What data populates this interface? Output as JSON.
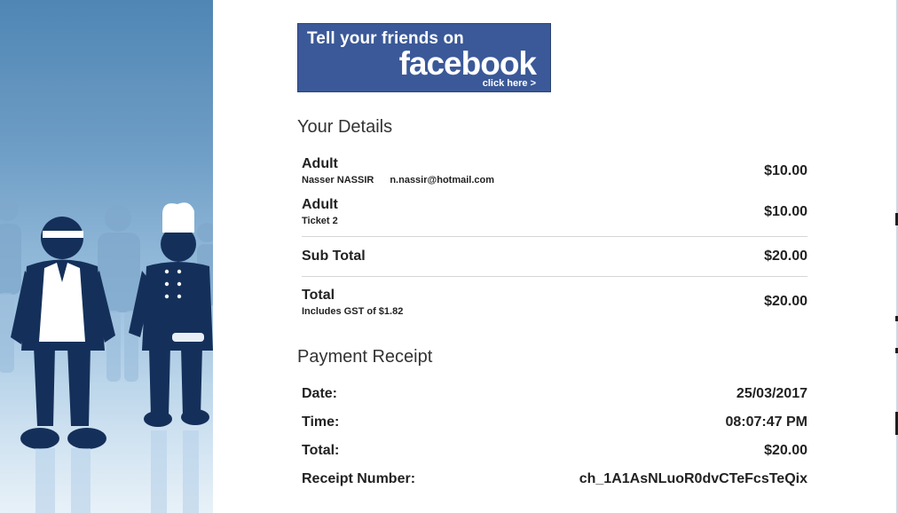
{
  "facebook_banner": {
    "line1": "Tell your friends on",
    "brand": "facebook",
    "cta": "click here >"
  },
  "your_details": {
    "title": "Your Details",
    "items": [
      {
        "type": "Adult",
        "name": "Nasser NASSIR",
        "email": "n.nassir@hotmail.com",
        "amount": "$10.00"
      },
      {
        "type": "Adult",
        "name": "Ticket 2",
        "email": "",
        "amount": "$10.00"
      }
    ],
    "subtotal": {
      "label": "Sub Total",
      "amount": "$20.00"
    },
    "total": {
      "label": "Total",
      "note": "Includes GST of $1.82",
      "amount": "$20.00"
    }
  },
  "payment_receipt": {
    "title": "Payment Receipt",
    "rows": [
      {
        "label": "Date:",
        "value": "25/03/2017"
      },
      {
        "label": "Time:",
        "value": "08:07:47 PM"
      },
      {
        "label": "Total:",
        "value": "$20.00"
      },
      {
        "label": "Receipt Number:",
        "value": "ch_1A1AsNLuoR0dvCTeFcsTeQix"
      }
    ]
  },
  "colors": {
    "facebook_blue": "#3b5998",
    "panel_blue": "#6f9ec6",
    "figure_navy": "#14305a"
  }
}
